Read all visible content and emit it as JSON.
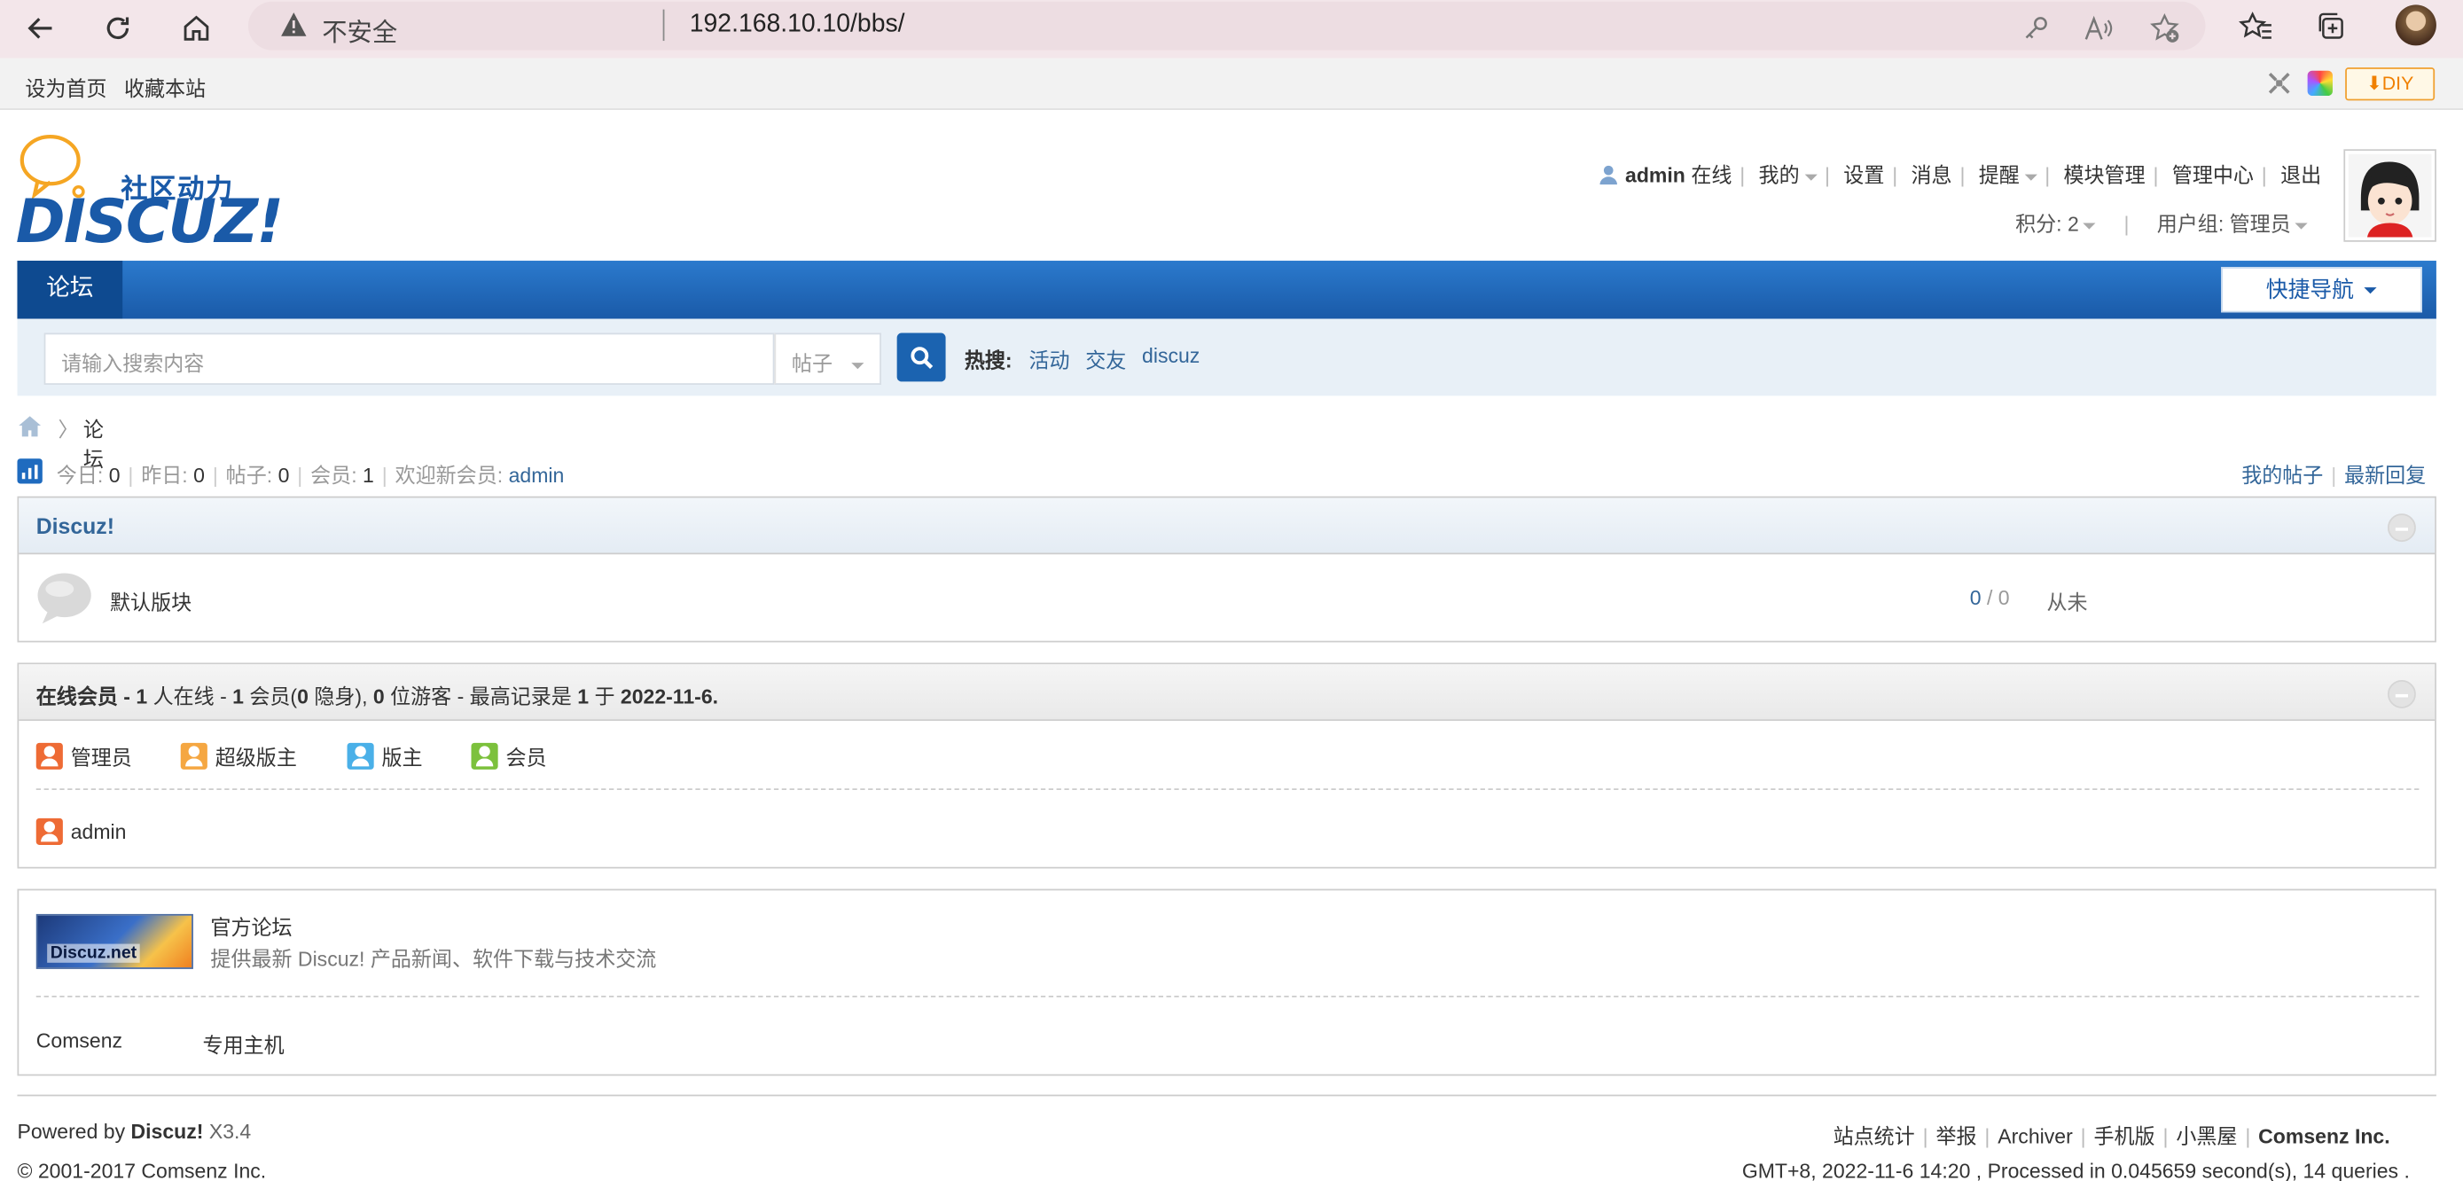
{
  "browser": {
    "insecure_label": "不安全",
    "url": "192.168.10.10/bbs/"
  },
  "topbar": {
    "set_home": "设为首页",
    "bookmark": "收藏本站",
    "diy": "DIY"
  },
  "logo": {
    "tagline": "社区动力",
    "brand": "DISCUZ!"
  },
  "user_menu": {
    "username": "admin",
    "online": "在线",
    "items": [
      "我的",
      "设置",
      "消息",
      "提醒",
      "模块管理",
      "管理中心",
      "退出"
    ],
    "credits_label": "积分: 2",
    "group_label": "用户组: 管理员"
  },
  "nav": {
    "tab": "论坛",
    "quick_nav": "快捷导航"
  },
  "search": {
    "placeholder": "请输入搜索内容",
    "type": "帖子",
    "hot_label": "热搜:",
    "hot_terms": [
      "活动",
      "交友",
      "discuz"
    ]
  },
  "breadcrumb": {
    "current": "论坛"
  },
  "stats": {
    "today_label": "今日:",
    "today": "0",
    "yesterday_label": "昨日:",
    "yesterday": "0",
    "posts_label": "帖子:",
    "posts": "0",
    "members_label": "会员:",
    "members": "1",
    "welcome_label": "欢迎新会员:",
    "newest": "admin",
    "my_posts": "我的帖子",
    "latest_replies": "最新回复"
  },
  "category": {
    "title": "Discuz!",
    "forum_name": "默认版块",
    "threads": "0",
    "slash": "/",
    "posts": "0",
    "last_post": "从未"
  },
  "online": {
    "header_prefix": "在线会员 - ",
    "count": "1",
    "mid1": " 人在线 - ",
    "members": "1",
    "mid2": " 会员(",
    "hidden": "0",
    "mid3": " 隐身), ",
    "guests": "0",
    "mid4": " 位游客 - 最高记录是 ",
    "record": "1",
    "mid5": " 于 ",
    "record_date": "2022-11-6.",
    "legend": [
      {
        "label": "管理员",
        "color": "#ee6b35"
      },
      {
        "label": "超级版主",
        "color": "#f5a742"
      },
      {
        "label": "版主",
        "color": "#4ab0e8"
      },
      {
        "label": "会员",
        "color": "#7cc13c"
      }
    ],
    "users": [
      "admin"
    ]
  },
  "links": {
    "official_title": "官方论坛",
    "official_desc": "提供最新 Discuz! 产品新闻、软件下载与技术交流",
    "banner_text": "Discuz.net",
    "text_links": [
      "Comsenz",
      "专用主机"
    ]
  },
  "footer": {
    "powered_prefix": "Powered by ",
    "product": "Discuz!",
    "version": " X3.4",
    "copyright": "© 2001-2017 Comsenz Inc.",
    "links": [
      "站点统计",
      "举报",
      "Archiver",
      "手机版",
      "小黑屋"
    ],
    "company": "Comsenz Inc.",
    "processed": "GMT+8, 2022-11-6 14:20 , Processed in 0.045659 second(s), 14 queries ."
  },
  "colors": {
    "nav_blue": "#1a5aa8",
    "link_blue": "#336699",
    "admin_orange": "#ee6b35"
  }
}
